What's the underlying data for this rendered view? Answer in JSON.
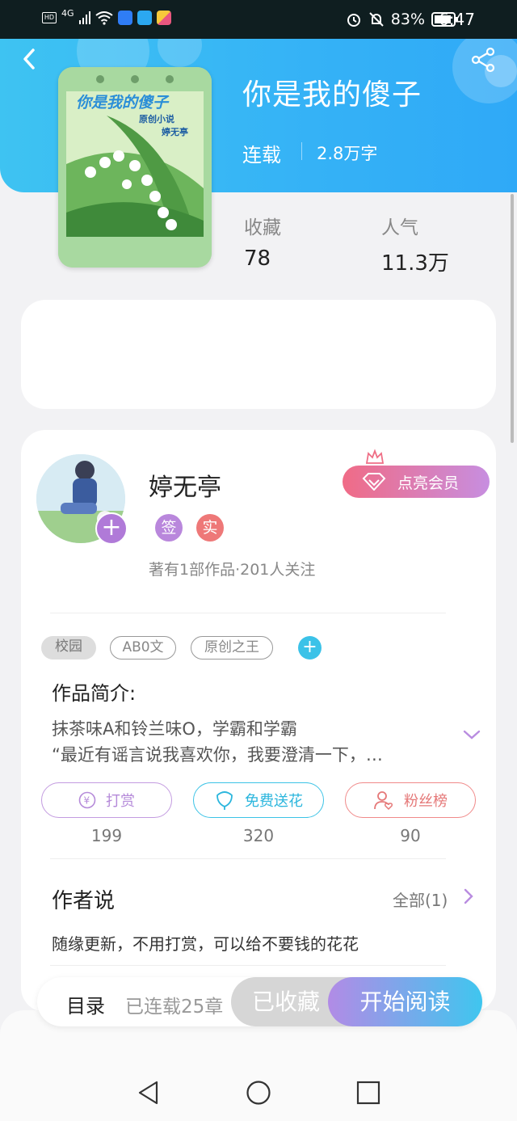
{
  "status_bar": {
    "left_label": "HD",
    "network": "4G",
    "battery": "83%",
    "time": "6:47"
  },
  "book": {
    "title": "你是我的傻子",
    "status": "连载",
    "word_count": "2.8万字",
    "cover_text_title": "你是我的傻子",
    "cover_text_sub": "原创小说",
    "cover_text_author": "婷无亭",
    "stats": [
      {
        "label": "收藏",
        "value": "78"
      },
      {
        "label": "人气",
        "value": "11.3万"
      }
    ]
  },
  "author": {
    "name": "婷无亭",
    "badges": [
      "签",
      "实"
    ],
    "info": "著有1部作品·201人关注",
    "vip_label": "点亮会员"
  },
  "tags": [
    "校园",
    "AB0文",
    "原创之王"
  ],
  "synopsis": {
    "label": "作品简介:",
    "line1": "抹茶味A和铃兰味O，学霸和学霸",
    "line2": "“最近有谣言说我喜欢你，我要澄清一下，…"
  },
  "actions": [
    {
      "label": "打赏",
      "count": "199",
      "color": "#c39be0"
    },
    {
      "label": "免费送花",
      "count": "320",
      "color": "#3cc3e6"
    },
    {
      "label": "粉丝榜",
      "count": "90",
      "color": "#f08a8a"
    }
  ],
  "author_says": {
    "label": "作者说",
    "all": "全部(1)",
    "text": "随缘更新，不用打赏，可以给不要钱的花花"
  },
  "bottom": {
    "catalog": "目录",
    "chapters": "已连载25章",
    "collected": "已收藏",
    "read": "开始阅读"
  },
  "colors": {
    "header": "#35b2f6",
    "accent_purple": "#b07ad8",
    "accent_cyan": "#3bc2e8"
  }
}
